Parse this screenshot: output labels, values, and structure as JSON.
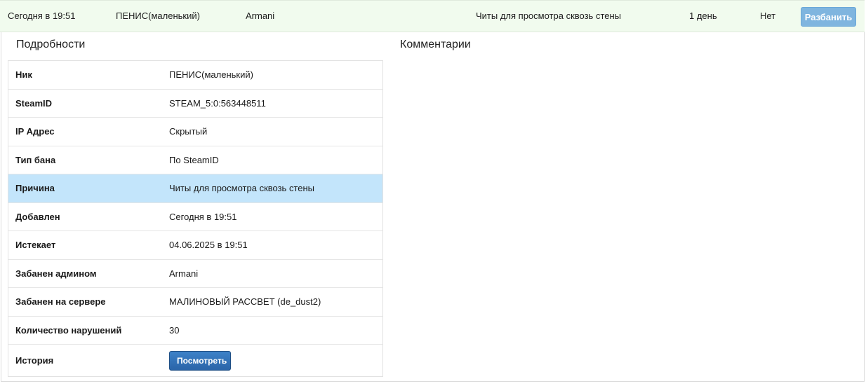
{
  "ban_row": {
    "date": "Сегодня в 19:51",
    "nick": "ПЕНИС(маленький)",
    "admin": "Armani",
    "reason": "Читы для просмотра сквозь стены",
    "duration": "1 день",
    "status": "Нет",
    "unban_label": "Разбанить"
  },
  "details": {
    "title": "Подробности",
    "rows": [
      {
        "label": "Ник",
        "value": "ПЕНИС(маленький)"
      },
      {
        "label": "SteamID",
        "value": "STEAM_5:0:563448511"
      },
      {
        "label": "IP Адрес",
        "value": "Скрытый"
      },
      {
        "label": "Тип бана",
        "value": "По SteamID"
      },
      {
        "label": "Причина",
        "value": "Читы для просмотра сквозь стены"
      },
      {
        "label": "Добавлен",
        "value": "Сегодня в 19:51"
      },
      {
        "label": "Истекает",
        "value": "04.06.2025 в 19:51"
      },
      {
        "label": "Забанен админом",
        "value": "Armani"
      },
      {
        "label": "Забанен на сервере",
        "value": "МАЛИНОВЫЙ РАССВЕТ (de_dust2)"
      },
      {
        "label": "Количество нарушений",
        "value": "30"
      },
      {
        "label": "История",
        "button_label": "Посмотреть"
      }
    ]
  },
  "comments": {
    "title": "Комментарии"
  },
  "colors": {
    "ban_row_bg": "#f1fbee",
    "highlight_row_bg": "#c3e5fb",
    "unban_button": "#7fb5df",
    "view_button": "#2f6fb5"
  }
}
